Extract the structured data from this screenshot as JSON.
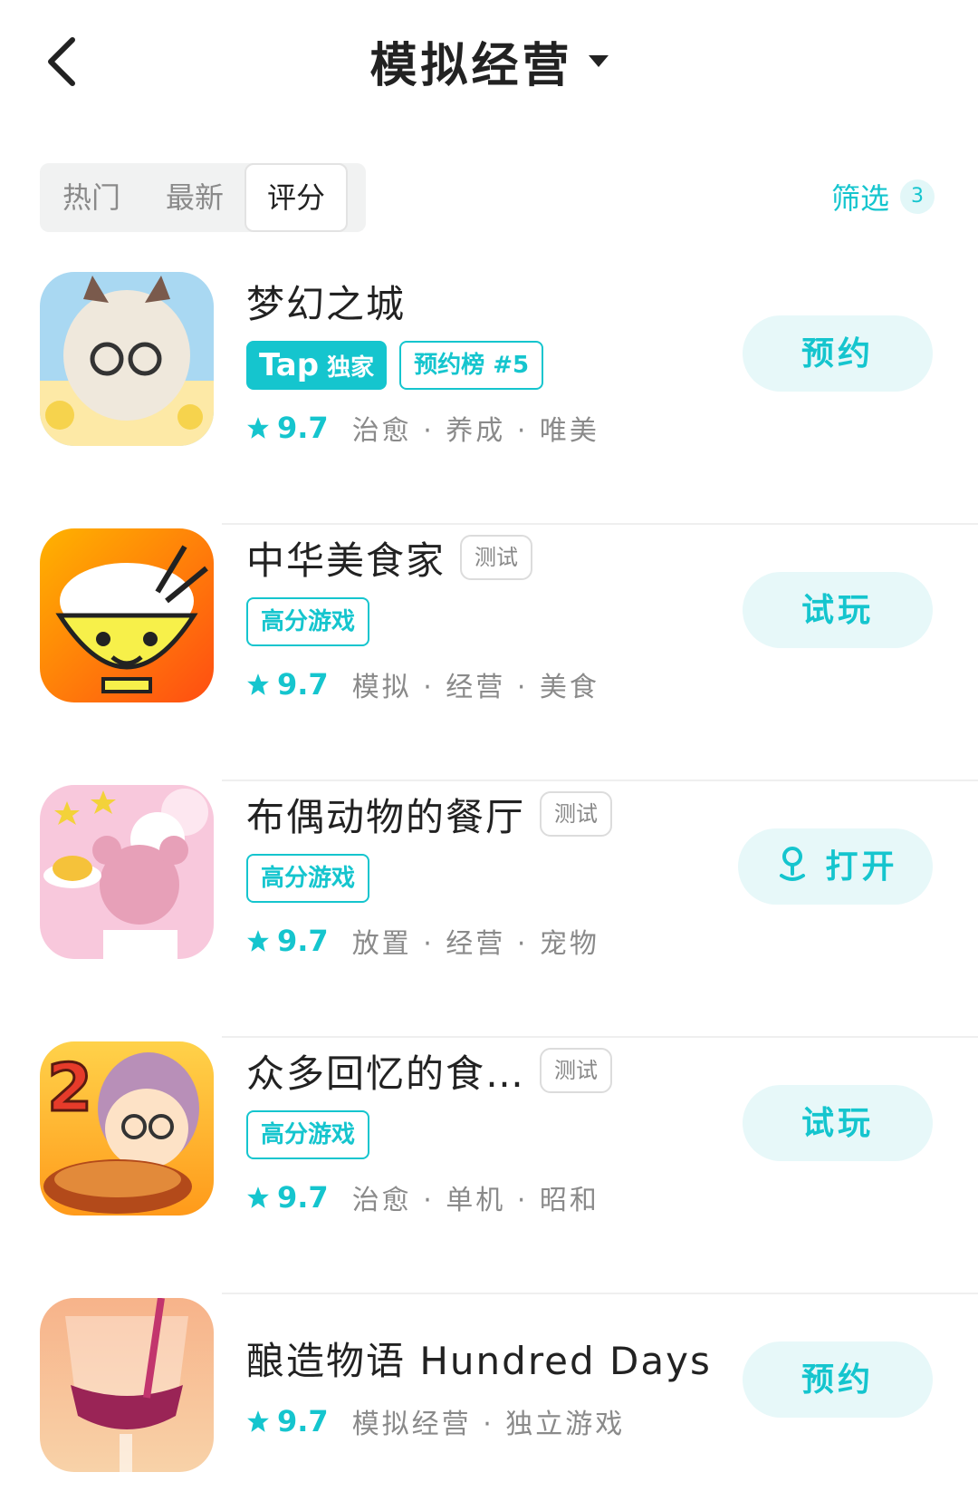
{
  "header": {
    "title": "模拟经营"
  },
  "tabs": {
    "items": [
      {
        "label": "热门"
      },
      {
        "label": "最新"
      },
      {
        "label": "评分"
      }
    ]
  },
  "filter": {
    "label": "筛选",
    "count": "3"
  },
  "games": [
    {
      "name": "梦幻之城",
      "tap_tag": {
        "en": "Tap",
        "zh": "独家"
      },
      "outline_tag": "预约榜 #5",
      "rating": "9.7",
      "genres": "治愈 · 养成 · 唯美",
      "action": "预约"
    },
    {
      "name": "中华美食家",
      "test_tag": "测试",
      "outline_tag": "高分游戏",
      "rating": "9.7",
      "genres": "模拟 · 经营 · 美食",
      "action": "试玩"
    },
    {
      "name": "布偶动物的餐厅",
      "test_tag": "测试",
      "outline_tag": "高分游戏",
      "rating": "9.7",
      "genres": "放置 · 经营 · 宠物",
      "action": "打开"
    },
    {
      "name": "众多回忆的食…",
      "test_tag": "测试",
      "outline_tag": "高分游戏",
      "rating": "9.7",
      "genres": "治愈 · 单机 · 昭和",
      "action": "试玩"
    },
    {
      "name": "酿造物语 Hundred Days",
      "rating": "9.7",
      "genres": "模拟经营 · 独立游戏",
      "action": "预约"
    }
  ],
  "colors": {
    "accent": "#15c5ce",
    "accent_light": "#e7f8f9",
    "muted_text": "#8a8a8a"
  }
}
